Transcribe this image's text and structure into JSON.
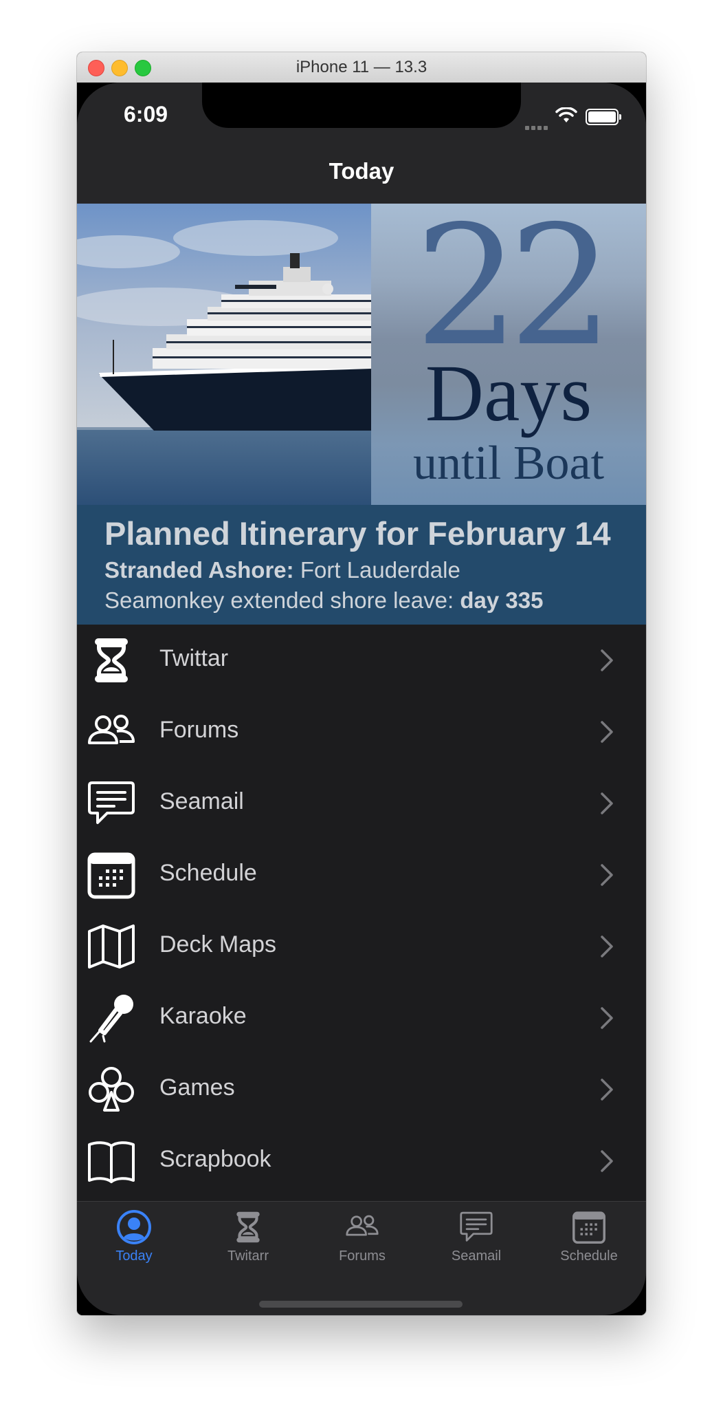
{
  "window": {
    "title": "iPhone 11 — 13.3"
  },
  "status_bar": {
    "time": "6:09"
  },
  "nav": {
    "title": "Today"
  },
  "hero": {
    "countdown_number": "22",
    "countdown_unit": "Days",
    "countdown_caption": "until Boat"
  },
  "itinerary": {
    "title": "Planned Itinerary for February 14",
    "line1_label": "Stranded Ashore:",
    "line1_value": " Fort Lauderdale",
    "line2_text": "Seamonkey extended shore leave: ",
    "line2_value": "day 335"
  },
  "menu": {
    "items": [
      {
        "label": "Twittar",
        "icon": "hourglass-icon"
      },
      {
        "label": "Forums",
        "icon": "people-icon"
      },
      {
        "label": "Seamail",
        "icon": "message-icon"
      },
      {
        "label": "Schedule",
        "icon": "calendar-icon"
      },
      {
        "label": "Deck Maps",
        "icon": "map-icon"
      },
      {
        "label": "Karaoke",
        "icon": "microphone-icon"
      },
      {
        "label": "Games",
        "icon": "club-icon"
      },
      {
        "label": "Scrapbook",
        "icon": "book-icon"
      }
    ]
  },
  "tabbar": {
    "tabs": [
      {
        "label": "Today",
        "icon": "person-circle-icon",
        "active": true
      },
      {
        "label": "Twitarr",
        "icon": "hourglass-icon",
        "active": false
      },
      {
        "label": "Forums",
        "icon": "people-icon",
        "active": false
      },
      {
        "label": "Seamail",
        "icon": "message-icon",
        "active": false
      },
      {
        "label": "Schedule",
        "icon": "calendar-icon",
        "active": false
      }
    ]
  },
  "colors": {
    "accent": "#3a82f7",
    "itinerary_bg": "#234a6b",
    "background": "#1c1c1e"
  }
}
